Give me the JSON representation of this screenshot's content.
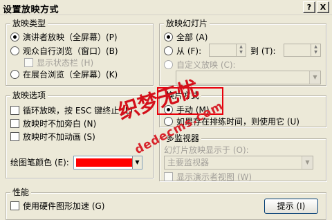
{
  "dialog": {
    "title": "设置放映方式",
    "help_button": "?",
    "close_button": "X"
  },
  "show_type": {
    "legend": "放映类型",
    "options": [
      {
        "label": "演讲者放映（全屏幕）(P)",
        "selected": true
      },
      {
        "label": "观众自行浏览（窗口）(B)",
        "selected": false
      },
      {
        "label": "在展台浏览（全屏幕）(K)",
        "selected": false
      }
    ],
    "show_status_bar": "显示状态栏 (H)"
  },
  "slides": {
    "legend": "放映幻灯片",
    "all_label": "全部 (A)",
    "from_label": "从 (F):",
    "to_label": "到 (T):",
    "custom_label": "自定义放映 (C):"
  },
  "show_options": {
    "legend": "放映选项",
    "loop": "循环放映，按 ESC 键终止 (L)",
    "no_narration": "放映时不加旁白 (N)",
    "no_animation": "放映时不加动画 (S)",
    "pen_color_label": "绘图笔颜色 (E):",
    "pen_color": "#ff0000"
  },
  "advance": {
    "legend": "换片方式",
    "manual": "手动 (M)",
    "use_timings": "如果存在排练时间，则使用它 (U)"
  },
  "multi_monitor": {
    "legend": "多监视器",
    "display_on_label": "幻灯片放映显示于 (O):",
    "display_on_value": "主要监视器",
    "presenter_view": "显示演示者视图 (W)"
  },
  "performance": {
    "legend": "性能",
    "hw_accel": "使用硬件图形加速 (G)",
    "tips_button": "提示 (I)"
  },
  "watermark": {
    "text": "织梦无忧",
    "url": "dedecms.com"
  },
  "colors": {
    "highlight": "#e8000b",
    "watermark": "#d4101b"
  }
}
